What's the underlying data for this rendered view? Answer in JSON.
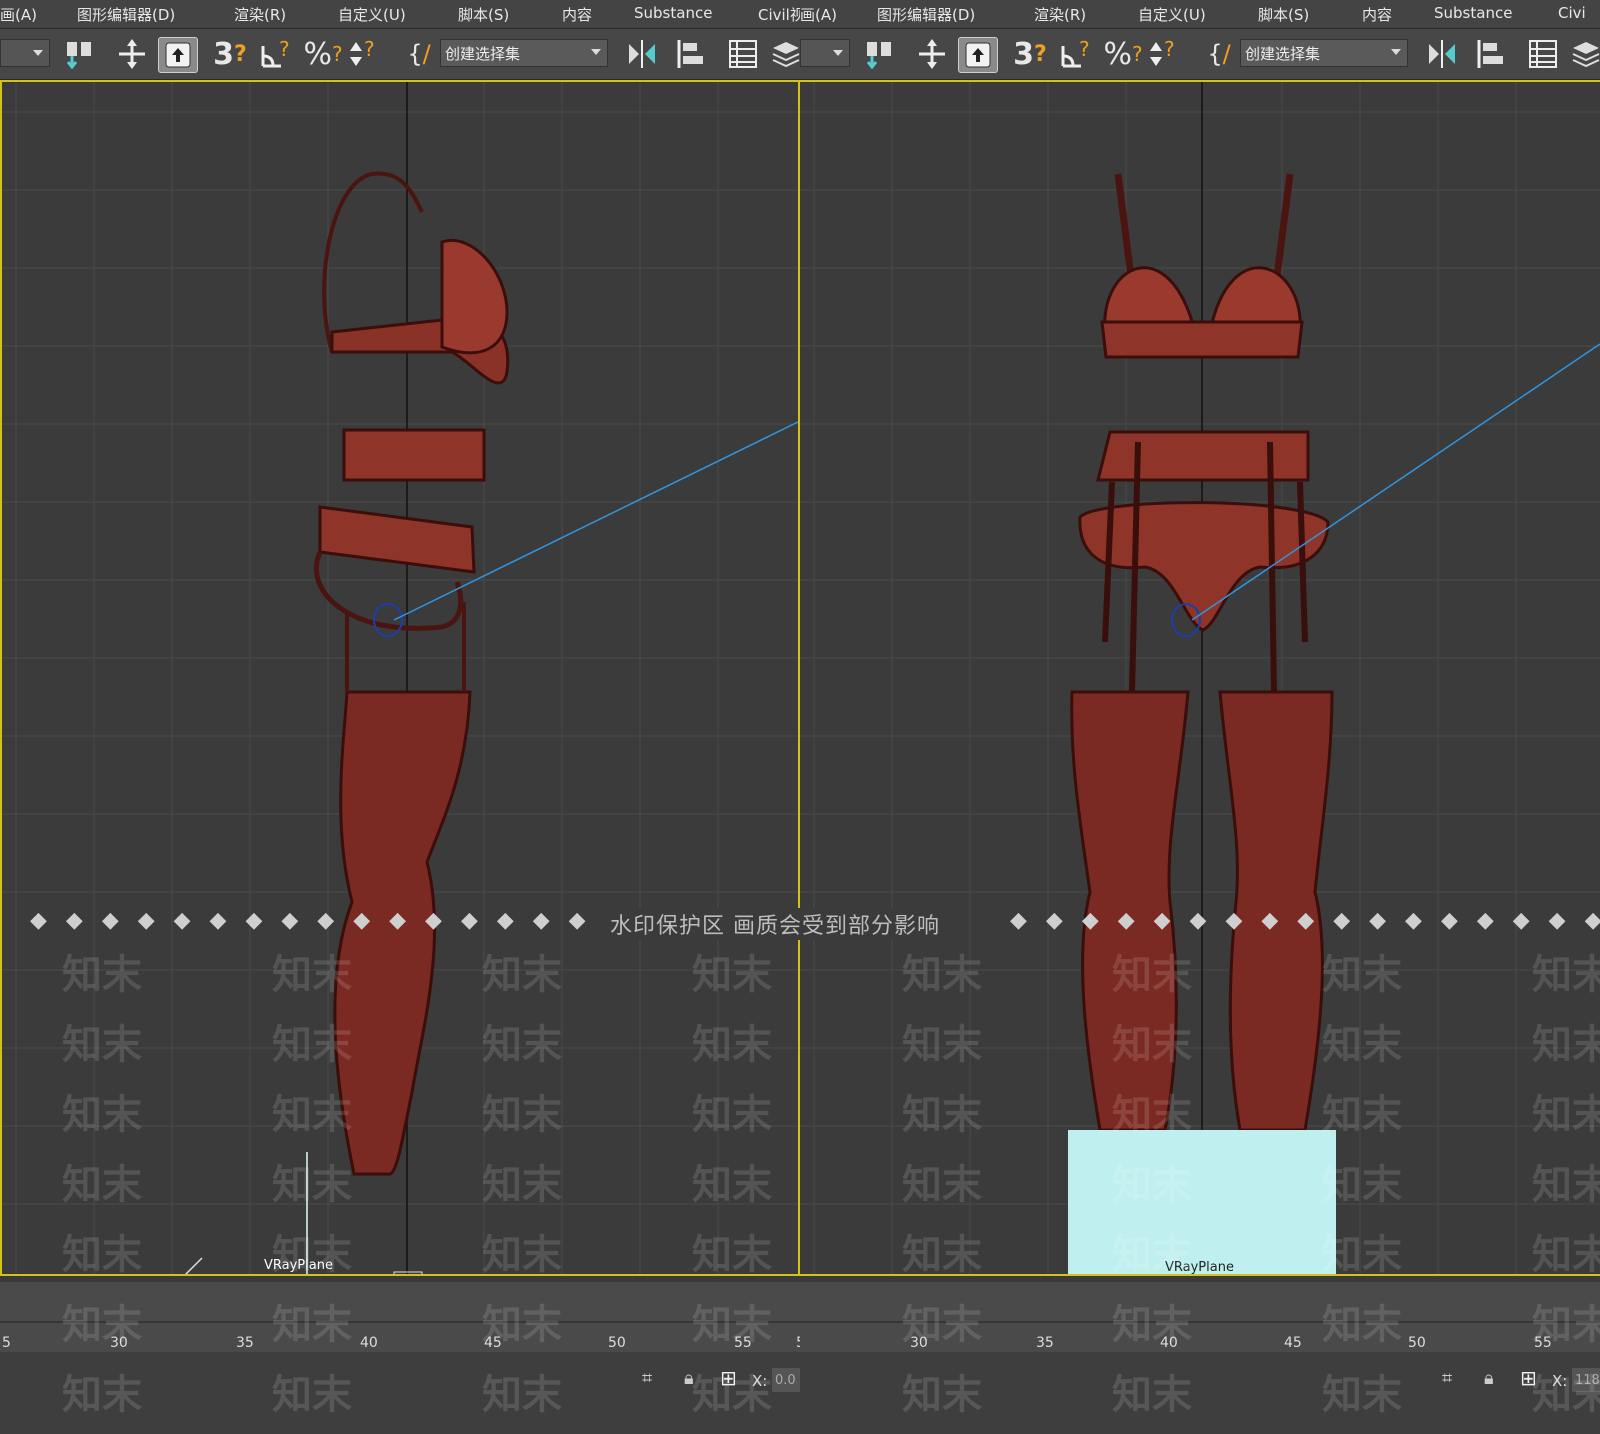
{
  "left": {
    "menu": [
      "画(A)",
      "图形编辑器(D)",
      "渲染(R)",
      "自定义(U)",
      "脚本(S)",
      "内容",
      "Substance",
      "Civil视(A)"
    ],
    "selection_set_placeholder": "创建选择集",
    "object_label": "VRayPlane",
    "timeline_ticks": [
      "5",
      "30",
      "35",
      "40",
      "45",
      "50",
      "55",
      "5"
    ],
    "coord_x_label": "X:",
    "coord_x_value": "0.0"
  },
  "right": {
    "menu": [
      "画(A)",
      "图形编辑器(D)",
      "渲染(R)",
      "自定义(U)",
      "脚本(S)",
      "内容",
      "Substance",
      "Civi"
    ],
    "selection_set_placeholder": "创建选择集",
    "object_label": "VRayPlane",
    "timeline_ticks": [
      "30",
      "35",
      "40",
      "45",
      "50",
      "55"
    ],
    "coord_x_label": "X:",
    "coord_x_value": "118"
  },
  "watermark": {
    "banner": "水印保护区  画质会受到部分影响",
    "brand": "知末"
  },
  "icons": [
    "select-link-icon",
    "move-icon",
    "select-object-icon",
    "snap-3d-icon",
    "angle-snap-icon",
    "percent-snap-icon",
    "spinner-snap-icon",
    "named-selection-icon",
    "mirror-icon",
    "align-icon",
    "scene-explorer-icon",
    "layer-manager-icon",
    "zoom-extents-icon",
    "lock-icon",
    "absolute-mode-icon"
  ],
  "colors": {
    "viewport_bg": "#3b3b3b",
    "grid": "#4d4d4d",
    "active_border": "#d4c314",
    "mesh": "#7a2a22",
    "vray_plane": "#bff0ef",
    "light_line": "#2f95e0"
  }
}
